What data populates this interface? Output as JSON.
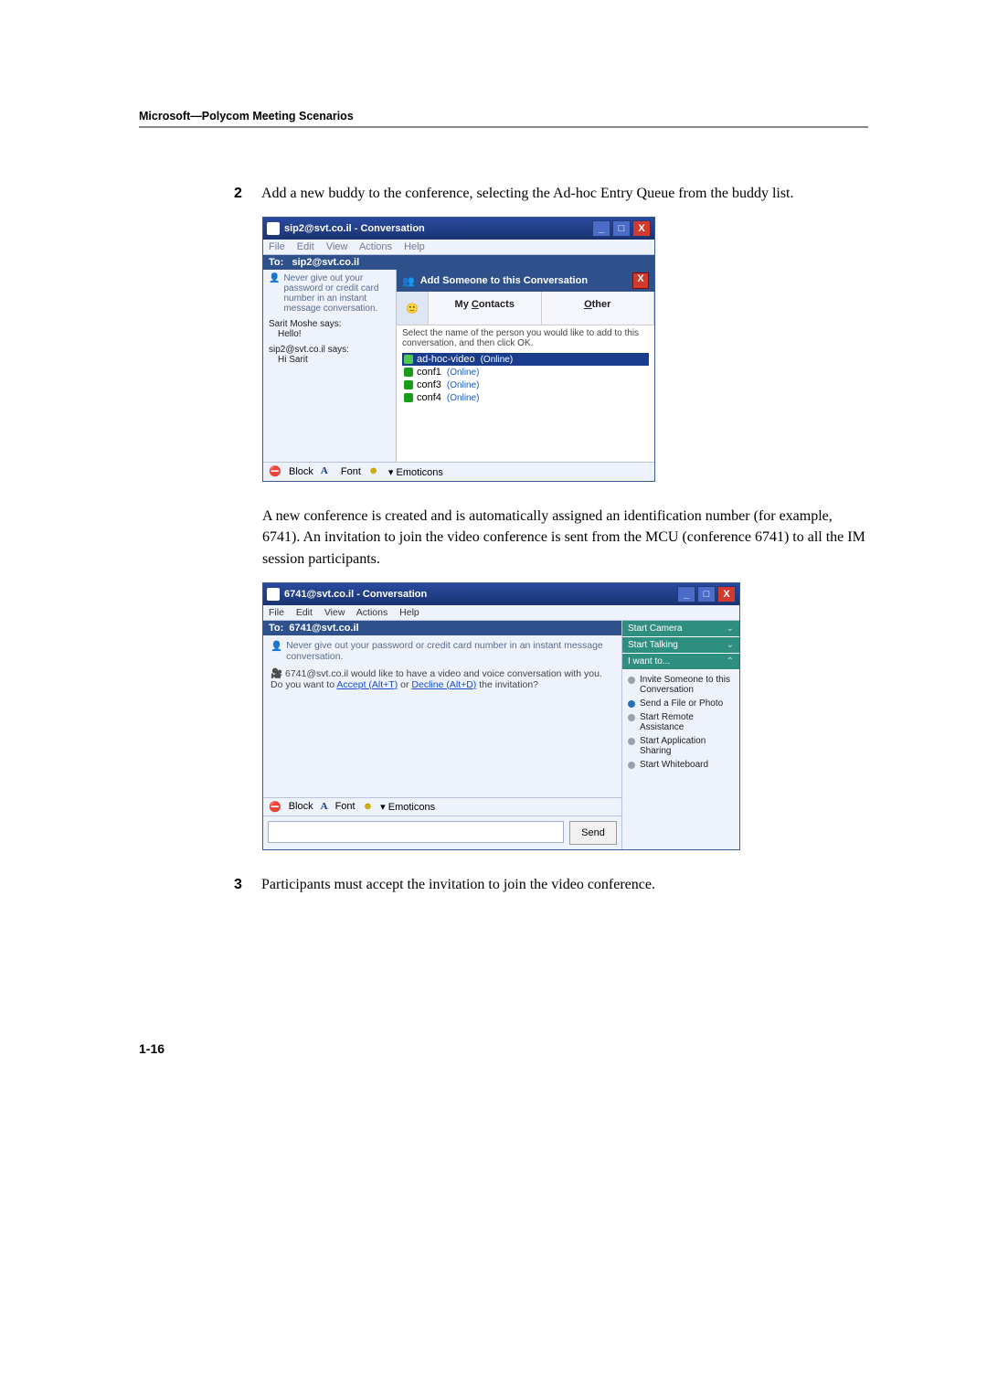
{
  "header": {
    "section_title": "Microsoft—Polycom Meeting Scenarios"
  },
  "steps": {
    "two": {
      "num": "2",
      "text": "Add a new buddy to the conference, selecting the Ad-hoc Entry Queue from the buddy list."
    },
    "three": {
      "num": "3",
      "text": "Participants must accept the invitation to join the video conference."
    }
  },
  "paragraph_mid": "A new conference is created and is automatically assigned an identification number (for example, 6741). An invitation to join the video conference is sent from the MCU (conference 6741) to all the IM session participants.",
  "ss1": {
    "title": "sip2@svt.co.il - Conversation",
    "menu": {
      "file": "File",
      "edit": "Edit",
      "view": "View",
      "actions": "Actions",
      "help": "Help"
    },
    "to_label": "To:",
    "to_value": "sip2@svt.co.il",
    "warn_text": "Never give out your password or credit card number in an instant message conversation.",
    "msgs": {
      "a_from": "Sarit Moshe says:",
      "a_body": "Hello!",
      "b_from": "sip2@svt.co.il says:",
      "b_body": "Hi Sarit"
    },
    "addbar": "Add Someone to this Conversation",
    "tabs": {
      "contacts": "My Contacts",
      "other": "Other"
    },
    "instruct": "Select the name of the person you would like to add to this conversation, and then click OK.",
    "contacts": [
      {
        "name": "ad-hoc-video",
        "status": "(Online)"
      },
      {
        "name": "conf1",
        "status": "(Online)"
      },
      {
        "name": "conf3",
        "status": "(Online)"
      },
      {
        "name": "conf4",
        "status": "(Online)"
      }
    ],
    "bottom": {
      "block": "Block",
      "font": "Font",
      "emoticons": "Emoticons"
    }
  },
  "ss2": {
    "title": "6741@svt.co.il - Conversation",
    "menu": {
      "file": "File",
      "edit": "Edit",
      "view": "View",
      "actions": "Actions",
      "help": "Help"
    },
    "to_label": "To:",
    "to_value": "6741@svt.co.il",
    "warn_text": "Never give out your password or credit card number in an instant message conversation.",
    "invite_prefix": "6741@svt.co.il would like to have a video and voice conversation with you. Do you want to ",
    "accept": "Accept (Alt+T)",
    "or": " or ",
    "decline": "Decline (Alt+D)",
    "invite_suffix": " the invitation?",
    "bottom": {
      "block": "Block",
      "font": "Font",
      "emoticons": "Emoticons"
    },
    "send": "Send",
    "side": {
      "camera": "Start Camera",
      "talking": "Start Talking",
      "want": "I want to...",
      "items": [
        "Invite Someone to this Conversation",
        "Send a File or Photo",
        "Start Remote Assistance",
        "Start Application Sharing",
        "Start Whiteboard"
      ]
    }
  },
  "page_num": "1-16"
}
